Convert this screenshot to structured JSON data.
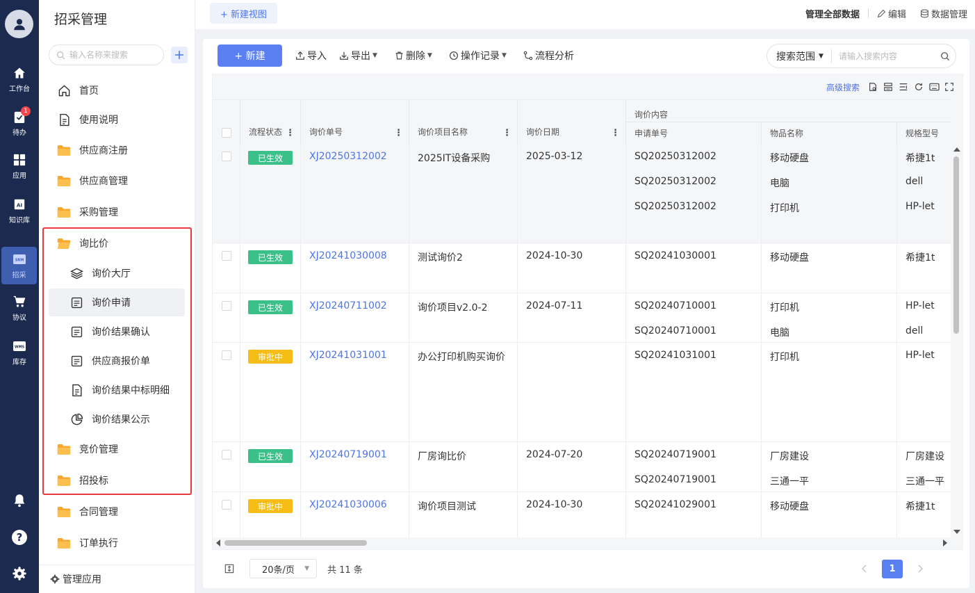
{
  "rail": {
    "items": [
      {
        "label": "工作台",
        "icon": "home-icon"
      },
      {
        "label": "待办",
        "icon": "todo-icon",
        "badge": "1"
      },
      {
        "label": "应用",
        "icon": "apps-icon"
      },
      {
        "label": "知识库",
        "icon": "knowledge-icon"
      },
      {
        "label": "招采",
        "icon": "srm-icon",
        "icon_text": "SRM",
        "active": true
      },
      {
        "label": "协议",
        "icon": "cart-icon"
      },
      {
        "label": "库存",
        "icon": "wms-icon",
        "icon_text": "WMS"
      }
    ]
  },
  "nav": {
    "title": "招采管理",
    "search_placeholder": "输入名称来搜索",
    "items": [
      {
        "label": "首页",
        "icon": "home-outline-icon"
      },
      {
        "label": "使用说明",
        "icon": "doc-icon"
      },
      {
        "label": "供应商注册",
        "icon": "folder-icon"
      },
      {
        "label": "供应商管理",
        "icon": "folder-icon"
      },
      {
        "label": "采购管理",
        "icon": "folder-icon"
      },
      {
        "label": "询比价",
        "icon": "folder-open-icon"
      },
      {
        "label": "询价大厅",
        "icon": "layers-icon"
      },
      {
        "label": "询价申请",
        "icon": "form-icon",
        "selected": true
      },
      {
        "label": "询价结果确认",
        "icon": "form-icon"
      },
      {
        "label": "供应商报价单",
        "icon": "form-icon"
      },
      {
        "label": "询价结果中标明细",
        "icon": "doc-icon"
      },
      {
        "label": "询价结果公示",
        "icon": "pie-icon"
      },
      {
        "label": "竞价管理",
        "icon": "folder-icon"
      },
      {
        "label": "招投标",
        "icon": "folder-icon"
      },
      {
        "label": "合同管理",
        "icon": "folder-icon"
      },
      {
        "label": "订单执行",
        "icon": "folder-icon"
      }
    ],
    "footer": "管理应用"
  },
  "topbar": {
    "new_view": "+ 新建视图",
    "manage_all": "管理全部数据",
    "edit": "编辑",
    "data_manage": "数据管理"
  },
  "toolbar": {
    "new": "+ 新建",
    "import": "导入",
    "export": "导出",
    "delete": "删除",
    "log": "操作记录",
    "flow": "流程分析",
    "scope": "搜索范围",
    "search_placeholder": "请输入搜索内容"
  },
  "grid": {
    "advanced_search": "高级搜索",
    "columns": {
      "status": "流程状态",
      "no": "询价单号",
      "name": "询价项目名称",
      "date": "询价日期",
      "group": "询价内容",
      "apply_no": "申请单号",
      "item": "物品名称",
      "spec": "规格型号"
    },
    "rows": [
      {
        "status": "已生效",
        "status_type": "ok",
        "no": "XJ20250312002",
        "name": "2025IT设备采购",
        "date": "2025-03-12",
        "lines": [
          {
            "apply_no": "SQ20250312002",
            "item": "移动硬盘",
            "spec": "希捷1t"
          },
          {
            "apply_no": "SQ20250312002",
            "item": "电脑",
            "spec": "dell"
          },
          {
            "apply_no": "SQ20250312002",
            "item": "打印机",
            "spec": "HP-let"
          }
        ]
      },
      {
        "status": "已生效",
        "status_type": "ok",
        "no": "XJ20241030008",
        "name": "测试询价2",
        "date": "2024-10-30",
        "lines": [
          {
            "apply_no": "SQ20241030001",
            "item": "移动硬盘",
            "spec": "希捷1t"
          }
        ]
      },
      {
        "status": "已生效",
        "status_type": "ok",
        "no": "XJ20240711002",
        "name": "询价项目v2.0-2",
        "date": "2024-07-11",
        "lines": [
          {
            "apply_no": "SQ20240710001",
            "item": "打印机",
            "spec": "HP-let"
          },
          {
            "apply_no": "SQ20240710001",
            "item": "电脑",
            "spec": "dell"
          }
        ]
      },
      {
        "status": "审批中",
        "status_type": "pend",
        "no": "XJ20241031001",
        "name": "办公打印机购买询价",
        "date": "",
        "lines": [
          {
            "apply_no": "SQ20241031001",
            "item": "打印机",
            "spec": "HP-let"
          }
        ]
      },
      {
        "status": "已生效",
        "status_type": "ok",
        "no": "XJ20240719001",
        "name": "厂房询比价",
        "date": "2024-07-20",
        "lines": [
          {
            "apply_no": "SQ20240719001",
            "item": "厂房建设",
            "spec": "厂房建设"
          },
          {
            "apply_no": "SQ20240719001",
            "item": "三通一平",
            "spec": "三通一平"
          }
        ]
      },
      {
        "status": "审批中",
        "status_type": "pend",
        "no": "XJ20241030006",
        "name": "询价项目测试",
        "date": "2024-10-30",
        "lines": [
          {
            "apply_no": "SQ20241029001",
            "item": "移动硬盘",
            "spec": "希捷1t"
          }
        ]
      }
    ]
  },
  "pager": {
    "page_size": "20条/页",
    "total": "共 11 条",
    "current": "1"
  }
}
